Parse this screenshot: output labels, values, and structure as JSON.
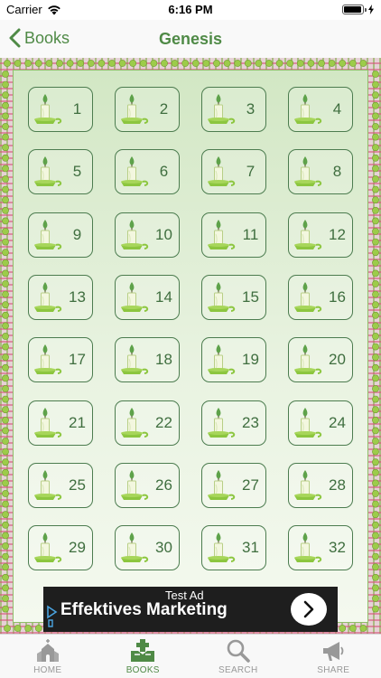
{
  "status_bar": {
    "carrier": "Carrier",
    "time": "6:16 PM",
    "battery_level": 0.95
  },
  "nav": {
    "back_label": "Books",
    "title": "Genesis"
  },
  "chapters": [
    "1",
    "2",
    "3",
    "4",
    "5",
    "6",
    "7",
    "8",
    "9",
    "10",
    "11",
    "12",
    "13",
    "14",
    "15",
    "16",
    "17",
    "18",
    "19",
    "20",
    "21",
    "22",
    "23",
    "24",
    "25",
    "26",
    "27",
    "28",
    "29",
    "30",
    "31",
    "32"
  ],
  "ad": {
    "badge": "Test Ad",
    "text": "Effektives Marketing"
  },
  "tabs": [
    {
      "label": "HOME",
      "icon": "church-icon",
      "active": false
    },
    {
      "label": "BOOKS",
      "icon": "book-plus-icon",
      "active": true
    },
    {
      "label": "SEARCH",
      "icon": "search-icon",
      "active": false
    },
    {
      "label": "SHARE",
      "icon": "megaphone-icon",
      "active": false
    }
  ],
  "colors": {
    "accent": "#4f8a46",
    "tile_border": "#4c7c4f",
    "inactive_tab": "#999999"
  }
}
